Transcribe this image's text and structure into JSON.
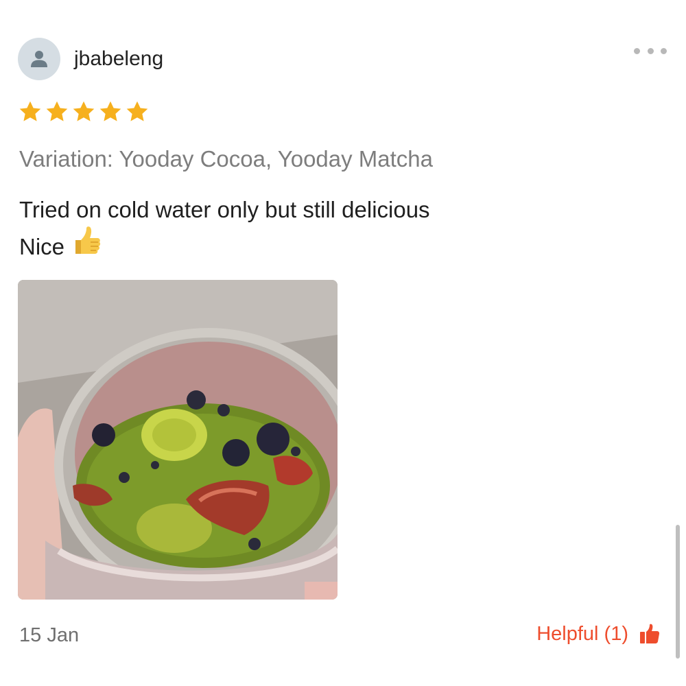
{
  "review": {
    "username": "jbabeleng",
    "rating": 5,
    "rating_max": 5,
    "variation": "Variation: Yooday Cocoa, Yooday Matcha",
    "comment_lines": [
      "Tried on cold water only but still delicious",
      "Nice"
    ],
    "comment_emoji": "thumbs-up-emoji",
    "photo": "review-photo-green-smoothie-jar",
    "date": "15 Jan",
    "helpful_label": "Helpful (1)",
    "helpful_count": 1
  },
  "icons": {
    "avatar": "user-placeholder-icon",
    "more": "more-dots-icon",
    "star": "star-icon",
    "helpful": "thumbs-up-icon"
  },
  "colors": {
    "star": "#f6b01e",
    "accent": "#ee4d2d",
    "avatar_bg": "#d5dde3",
    "avatar_fg": "#6b7c87"
  }
}
